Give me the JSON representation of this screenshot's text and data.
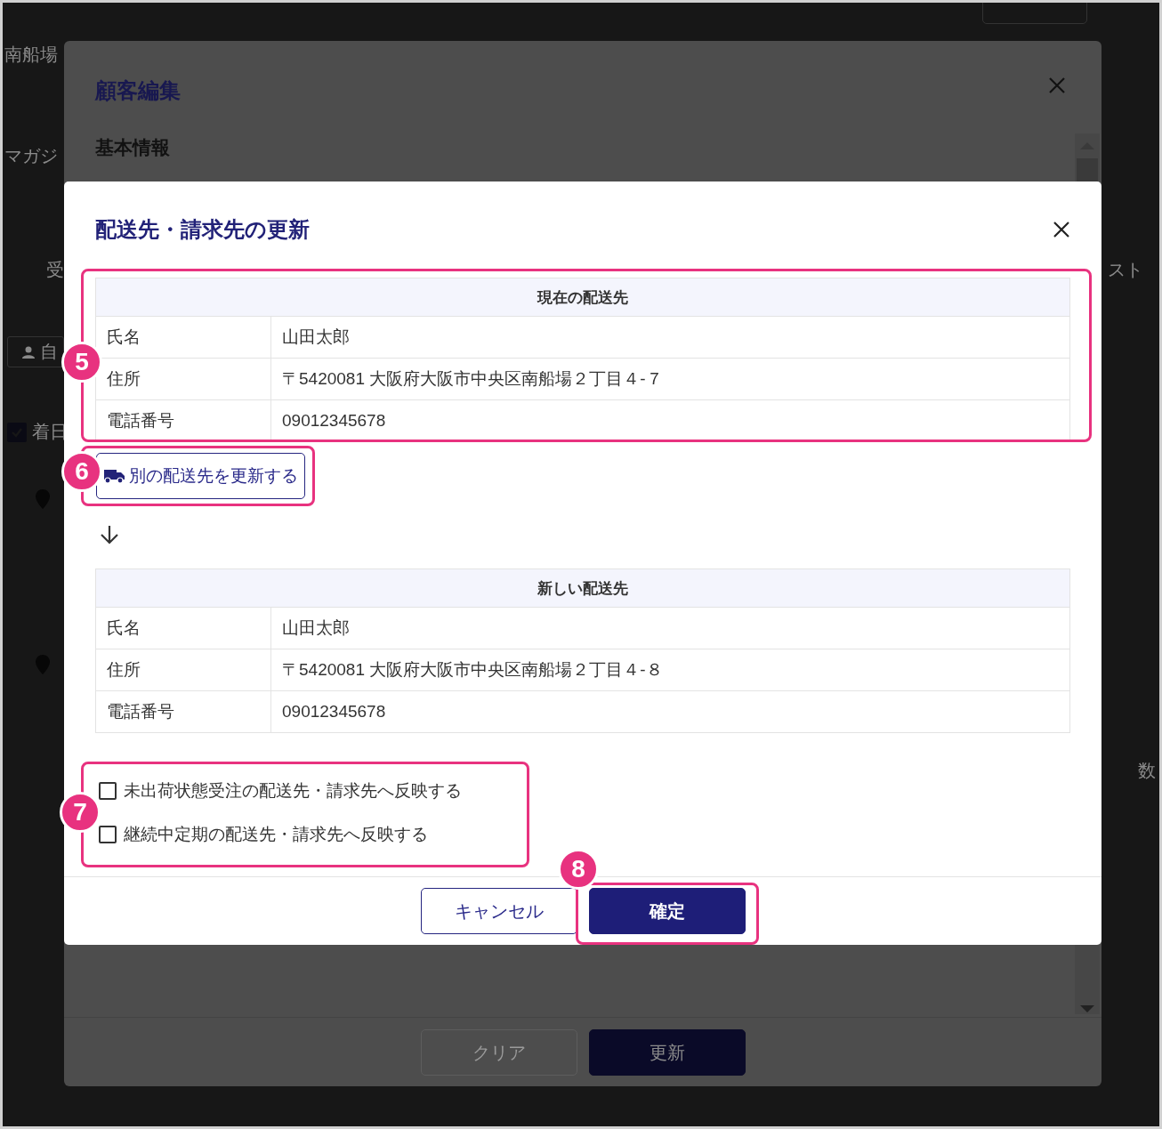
{
  "background_page": {
    "fragments": [
      {
        "text": "南船場",
        "kind": "text"
      },
      {
        "text": "マガジ",
        "kind": "text"
      },
      {
        "text": "受",
        "kind": "text"
      },
      {
        "text": "自",
        "kind": "person-button"
      },
      {
        "text": "着日",
        "kind": "checkbox",
        "checked": true
      },
      {
        "text": "スト",
        "kind": "text"
      },
      {
        "text": "数",
        "kind": "text"
      }
    ]
  },
  "customer_edit_dialog": {
    "title": "顧客編集",
    "section": "基本情報",
    "buttons": [
      {
        "label": "クリア",
        "kind": "secondary"
      },
      {
        "label": "更新",
        "kind": "primary"
      }
    ]
  },
  "update_dialog": {
    "title": "配送先・請求先の更新",
    "current_address": {
      "heading": "現在の配送先",
      "rows": [
        {
          "label": "氏名",
          "value": "山田太郎"
        },
        {
          "label": "住所",
          "value": "〒5420081 大阪府大阪市中央区南船場２丁目４-７"
        },
        {
          "label": "電話番号",
          "value": "09012345678"
        }
      ]
    },
    "change_button": "別の配送先を更新する",
    "new_address": {
      "heading": "新しい配送先",
      "rows": [
        {
          "label": "氏名",
          "value": "山田太郎"
        },
        {
          "label": "住所",
          "value": "〒5420081 大阪府大阪市中央区南船場２丁目４-８"
        },
        {
          "label": "電話番号",
          "value": "09012345678"
        }
      ]
    },
    "options": [
      {
        "label": "未出荷状態受注の配送先・請求先へ反映する",
        "checked": false
      },
      {
        "label": "継続中定期の配送先・請求先へ反映する",
        "checked": false
      }
    ],
    "buttons": [
      {
        "label": "キャンセル",
        "kind": "secondary"
      },
      {
        "label": "確定",
        "kind": "primary"
      }
    ]
  },
  "callouts": [
    {
      "number": "5"
    },
    {
      "number": "6"
    },
    {
      "number": "7"
    },
    {
      "number": "8"
    }
  ]
}
